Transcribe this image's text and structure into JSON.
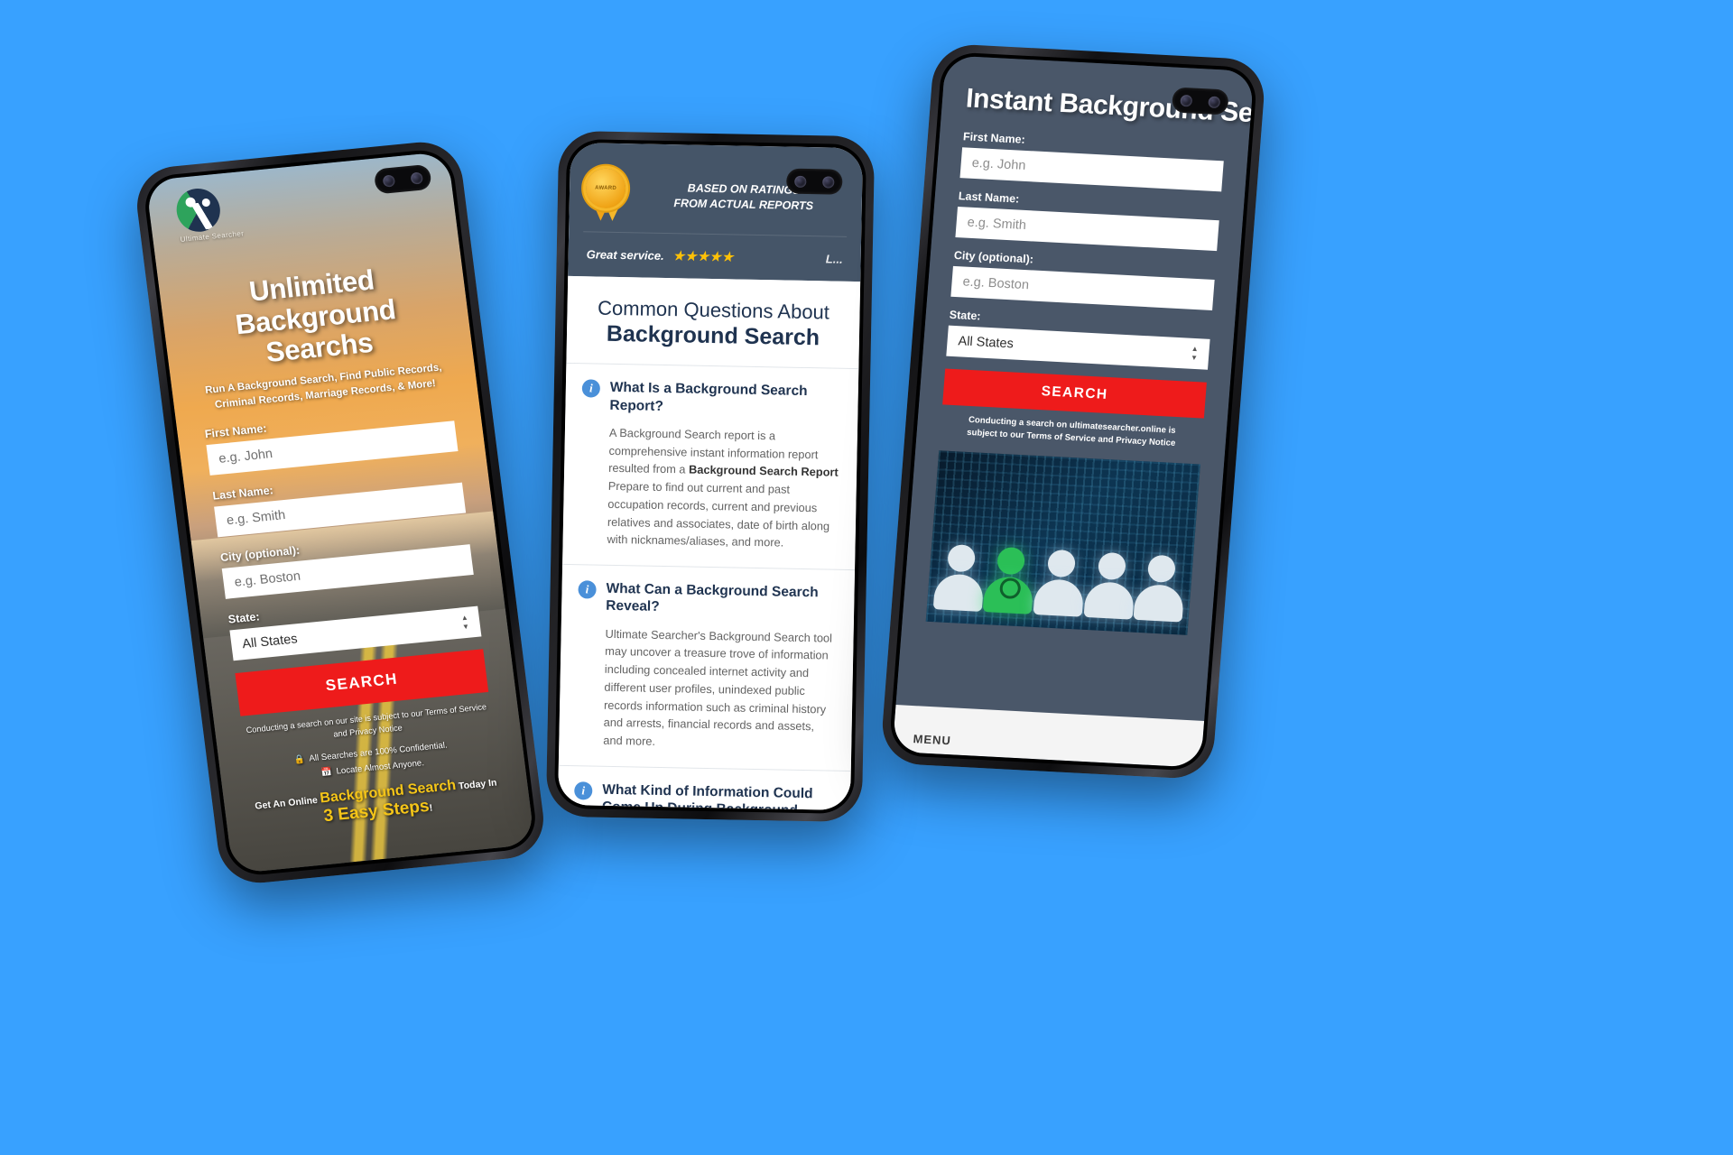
{
  "background_color": "#38a1ff",
  "accent_red": "#ee1b1b",
  "accent_gold": "#f5c518",
  "left_phone": {
    "brand": {
      "name": "Ultimate Searcher",
      "logo_icon": "ultimate-searcher-logo"
    },
    "headline": "Unlimited Background Searchs",
    "subheadline": "Run A Background Search, Find Public Records, Criminal Records, Marriage Records, & More!",
    "form": {
      "first_name_label": "First Name:",
      "first_name_placeholder": "e.g. John",
      "last_name_label": "Last Name:",
      "last_name_placeholder": "e.g. Smith",
      "city_label": "City (optional):",
      "city_placeholder": "e.g. Boston",
      "state_label": "State:",
      "state_value": "All States",
      "search_button": "SEARCH"
    },
    "terms": "Conducting a search on our site is subject to our Terms of Service and Privacy Notice",
    "assurances": [
      {
        "icon": "lock-icon",
        "text": "All Searches are 100% Confidential."
      },
      {
        "icon": "calendar-icon",
        "text": "Locate Almost Anyone."
      }
    ],
    "steps_pre": "Get An Online",
    "steps_highlight": "Background Search",
    "steps_mid": "Today In",
    "steps_big": "3 Easy Steps",
    "steps_end": "!"
  },
  "middle_phone": {
    "award_badge": "AWARD",
    "rating_line1": "BASED ON RATINGS",
    "rating_line2": "FROM ACTUAL REPORTS",
    "review_text": "Great service.",
    "review_stars": "★★★★★",
    "review_author": "L...",
    "faq_title_line1": "Common Questions About",
    "faq_title_line2": "Background Search",
    "faqs": [
      {
        "icon": "info-icon",
        "question": "What Is a Background Search Report?",
        "answer_pre": "A Background Search report is a comprehensive instant information report resulted from a ",
        "answer_bold": "Background Search Report",
        "answer_post": " Prepare to find out current and past occupation records, current and previous relatives and associates, date of birth along with nicknames/aliases, and more."
      },
      {
        "icon": "info-icon",
        "question": "What Can a Background Search Reveal?",
        "answer": "Ultimate Searcher's Background Search tool may uncover a treasure trove of information including concealed internet activity and different user profiles, unindexed public records information such as criminal history and arrests, financial records and assets, and more."
      },
      {
        "icon": "info-icon",
        "question": "What Kind of Information Could Come Up During Background Search?",
        "answer": ""
      }
    ]
  },
  "right_phone": {
    "headline": "Instant Background Search",
    "form": {
      "first_name_label": "First Name:",
      "first_name_placeholder": "e.g. John",
      "last_name_label": "Last Name:",
      "last_name_placeholder": "e.g. Smith",
      "city_label": "City (optional):",
      "city_placeholder": "e.g. Boston",
      "state_label": "State:",
      "state_value": "All States",
      "search_button": "SEARCH"
    },
    "terms_line1": "Conducting a search on ultimatesearcher.online is",
    "terms_line2": "subject to our Terms of Service and Privacy Notice",
    "photo_alt": "people-silhouettes-digital-background",
    "menu_label": "MENU"
  }
}
